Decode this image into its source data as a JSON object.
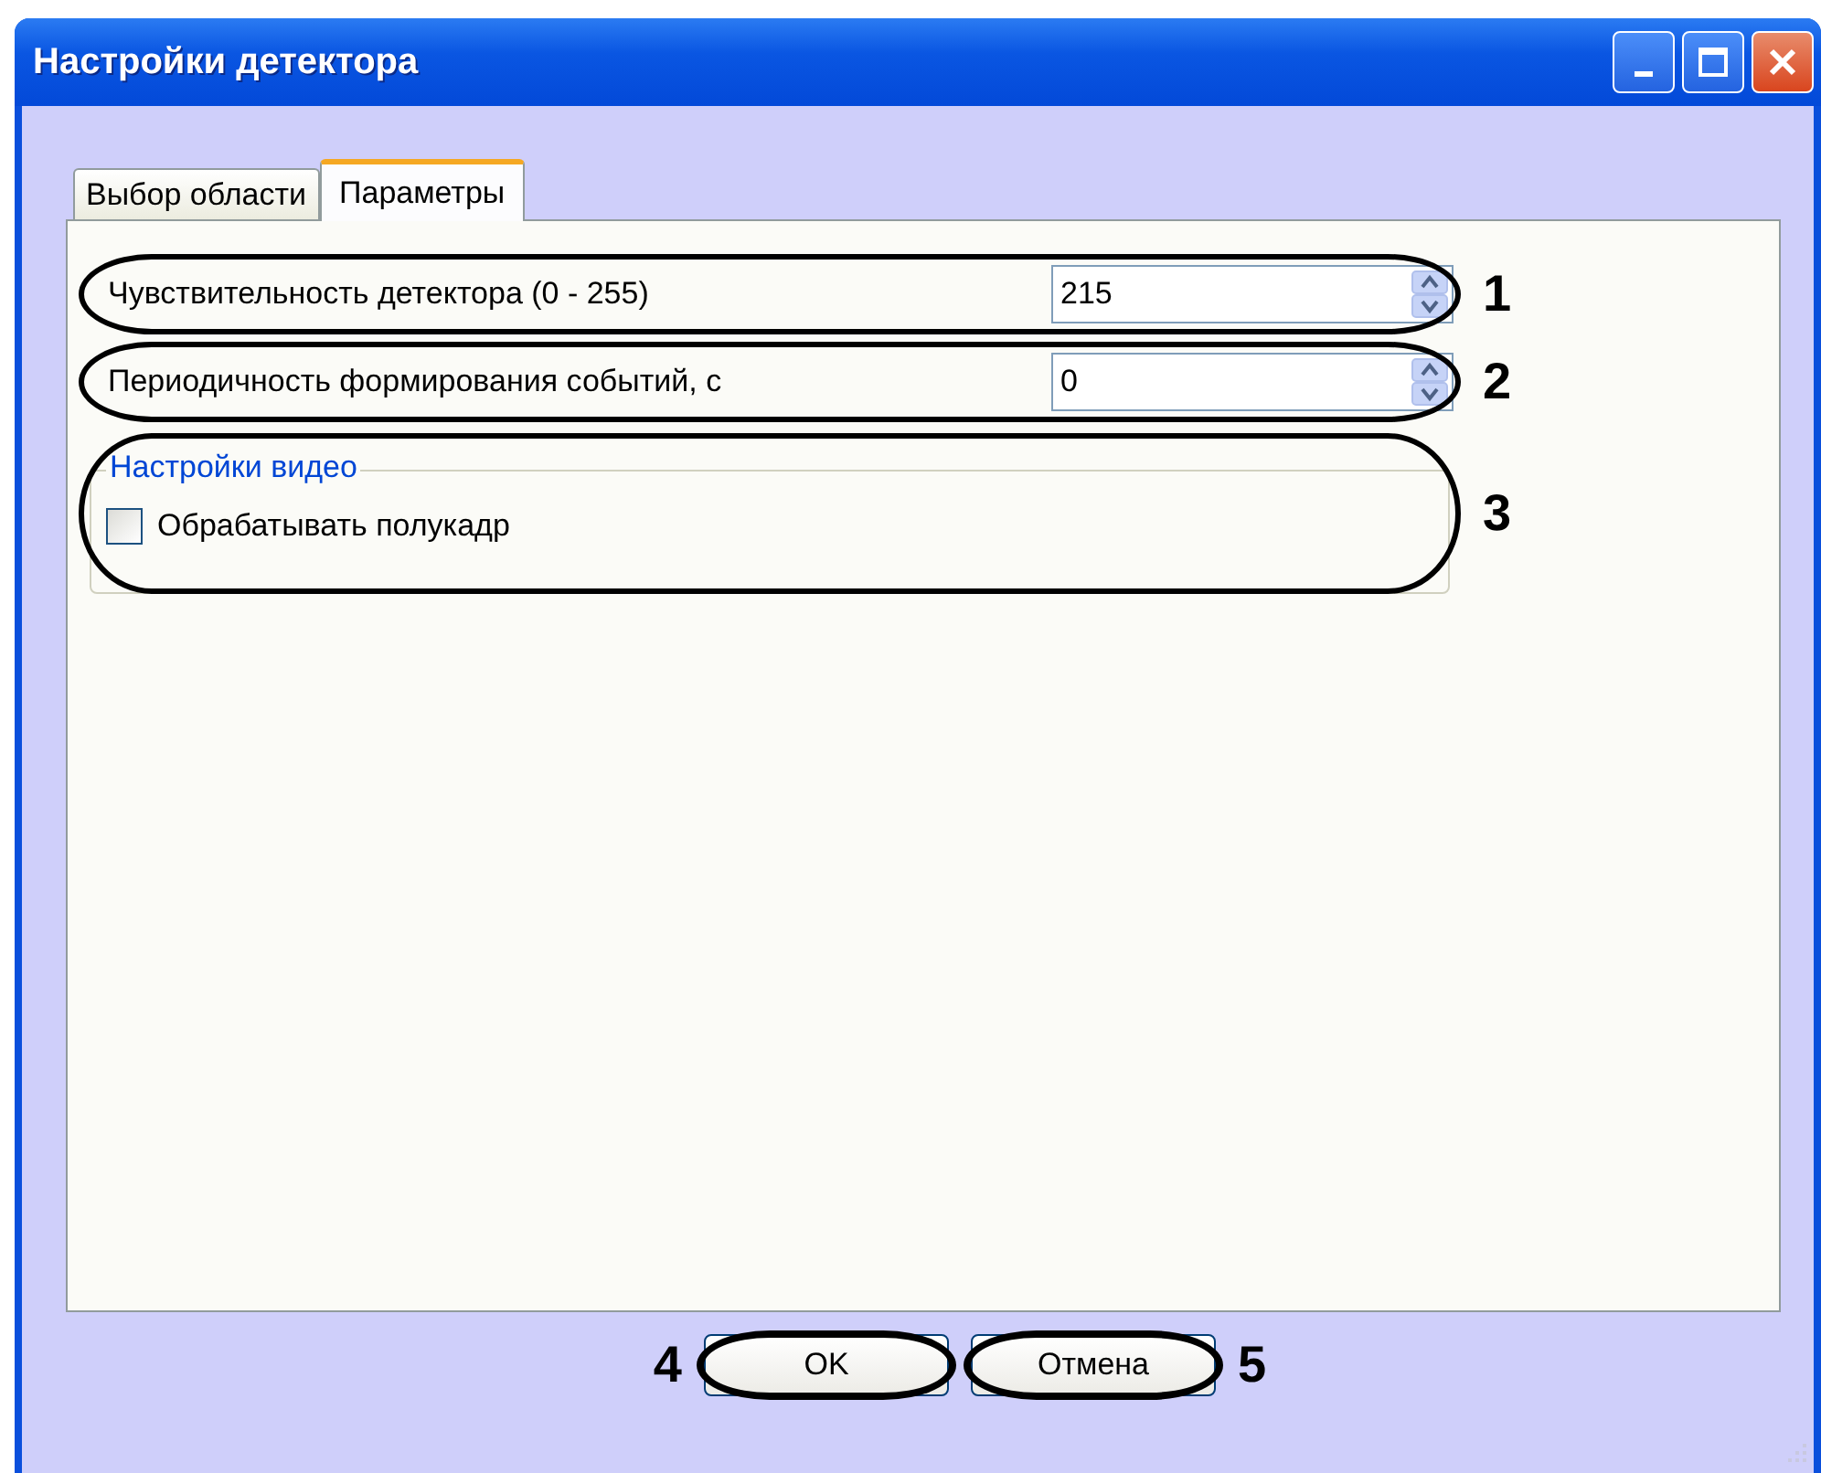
{
  "window": {
    "title": "Настройки детектора"
  },
  "tabs": [
    {
      "label": "Выбор области",
      "selected": false
    },
    {
      "label": "Параметры",
      "selected": true
    }
  ],
  "fields": [
    {
      "label": "Чувствительность детектора (0 - 255)",
      "value": "215",
      "callout": "1"
    },
    {
      "label": "Периодичность формирования событий, с",
      "value": "0",
      "callout": "2"
    }
  ],
  "video_group": {
    "title": "Настройки видео",
    "callout": "3",
    "checkbox": {
      "label": "Обрабатывать полукадр",
      "checked": false
    }
  },
  "button_row": [
    {
      "kind": "callout",
      "text": "4"
    },
    {
      "kind": "button",
      "label": "OK",
      "circled": true
    },
    {
      "kind": "button",
      "label": "Отмена",
      "circled": true
    },
    {
      "kind": "callout",
      "text": "5"
    }
  ]
}
